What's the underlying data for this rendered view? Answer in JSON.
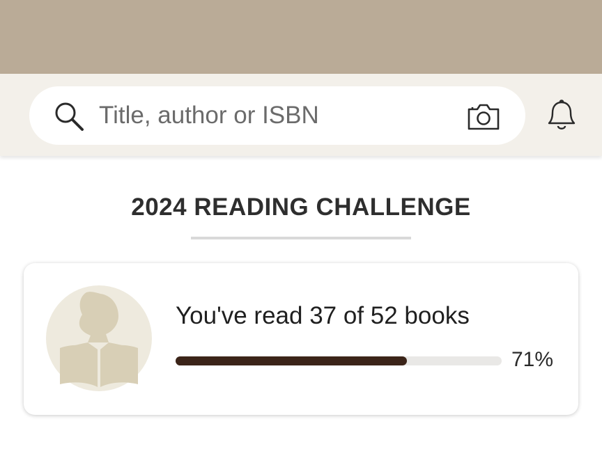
{
  "search": {
    "placeholder": "Title, author or ISBN"
  },
  "icons": {
    "search": "search-icon",
    "camera": "camera-icon",
    "notifications": "bell-icon",
    "avatar": "reader-silhouette"
  },
  "challenge": {
    "title": "2024 READING CHALLENGE",
    "progress_text": "You've read 37 of 52 books",
    "books_read": 37,
    "books_goal": 52,
    "progress_fraction": 0.71,
    "progress_percent_label": "71%"
  },
  "colors": {
    "status_bar": "#baab97",
    "header_bg": "#f3f0ea",
    "progress_fill": "#3b2419",
    "progress_track": "#e9e8e6",
    "avatar_bg": "#eeeade",
    "avatar_figure": "#d8cfb6"
  }
}
